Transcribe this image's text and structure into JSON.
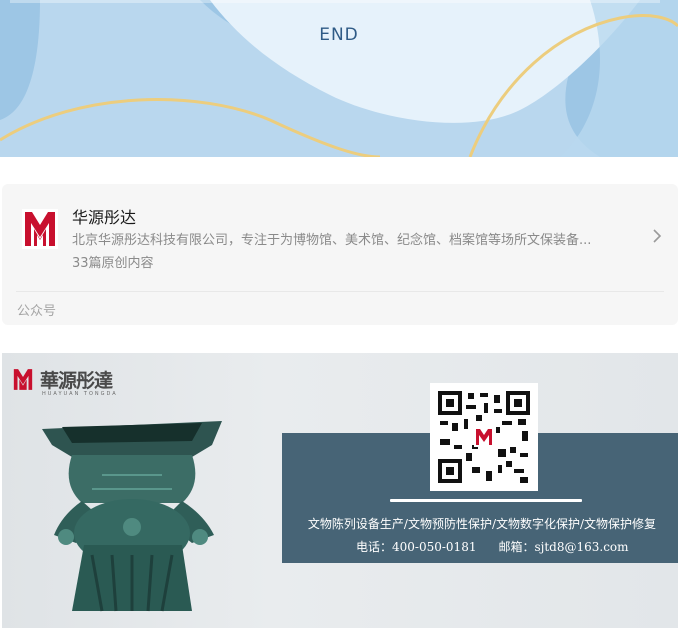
{
  "banner": {
    "end_label": "END"
  },
  "account": {
    "name": "华源彤达",
    "description": "北京华源彤达科技有限公司，专注于为博物馆、美术馆、纪念馆、档案馆等场所文保装备...",
    "article_count": "33篇原创内容",
    "type_label": "公众号"
  },
  "promo": {
    "brand_name": "華源彤達",
    "brand_sub": "HUAYUAN TONGDA",
    "services": "文物陈列设备生产/文物预防性保护/文物数字化保护/文物保护修复",
    "phone_label": "电话：400-050-0181",
    "email_label": "邮箱：sjtd8@163.com"
  },
  "colors": {
    "brand_red": "#c8102e",
    "banner_blue": "#9fc7e5",
    "panel_slate": "#476476"
  },
  "icons": {
    "logo": "huayuan-logo-icon",
    "chevron": "chevron-right-icon",
    "qr": "qr-code-icon"
  }
}
